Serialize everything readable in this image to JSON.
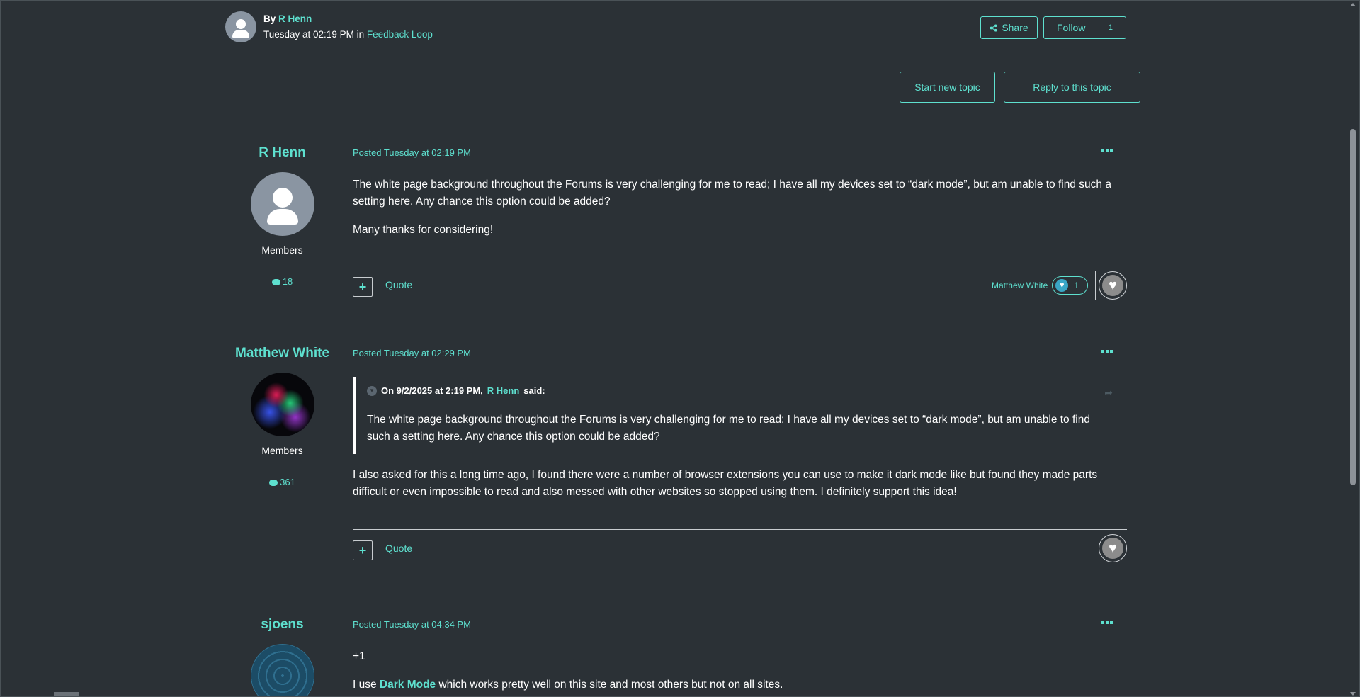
{
  "header": {
    "by_label": "By",
    "author": "R Henn",
    "date": "Tuesday at 02:19 PM",
    "in_label": "in",
    "forum": "Feedback Loop",
    "share_label": "Share",
    "follow_label": "Follow",
    "follow_count": "1",
    "start_topic_label": "Start new topic",
    "reply_label": "Reply to this topic"
  },
  "posts": [
    {
      "author": "R Henn",
      "group": "Members",
      "post_count": "18",
      "posted": "Posted Tuesday at 02:19 PM",
      "paragraphs": [
        "The white page background throughout the Forums is very challenging for me to read; I have all my devices set to “dark mode”, but am unable to find such a setting here. Any chance this option could be added?",
        "Many thanks for considering!"
      ],
      "quote_label": "Quote",
      "reacted_by": "Matthew White",
      "reaction_count": "1"
    },
    {
      "author": "Matthew White",
      "group": "Members",
      "post_count": "361",
      "posted": "Posted Tuesday at 02:29 PM",
      "quote": {
        "on_label": "On 9/2/2025 at 2:19 PM,",
        "quoted_author": "R Henn",
        "said_label": "said:",
        "text": "The white page background throughout the Forums is very challenging for me to read; I have all my devices set to “dark mode”, but am unable to find such a setting here. Any chance this option could be added?"
      },
      "paragraphs": [
        "I also asked for this a long time ago, I found there were a number of browser extensions you can use to make it dark mode like but found they made parts difficult or even impossible to read and also messed with other websites so stopped using them. I definitely support this idea!"
      ],
      "quote_label": "Quote"
    },
    {
      "author": "sjoens",
      "posted": "Posted Tuesday at 04:34 PM",
      "p1": "+1",
      "p2_before": "I use",
      "p2_link": "Dark Mode",
      "p2_after": "which works pretty well on this site and most others but not on all sites."
    }
  ],
  "icons": {
    "share": "share-icon",
    "more": "more-options-icon",
    "plus": "plus-icon",
    "heart": "heart-icon",
    "comment": "comment-icon",
    "chevron": "chevron-down-icon",
    "reply_arrow": "share-arrow-icon"
  },
  "colors": {
    "background": "#2b3136",
    "accent": "#5ee0cf",
    "text": "#ffffff"
  }
}
